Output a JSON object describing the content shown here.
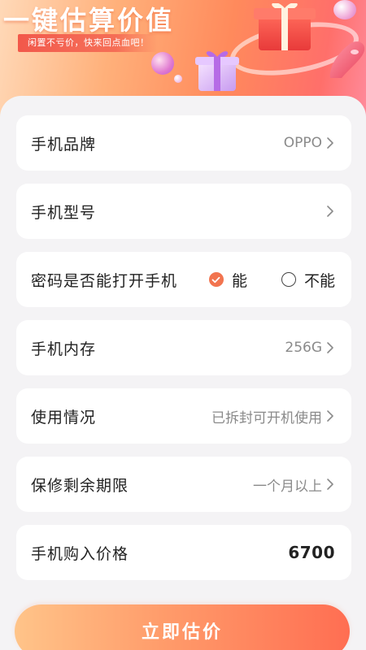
{
  "hero": {
    "title": "一键估算价值",
    "subtitle": "闲置不亏价，快来回点血吧！"
  },
  "form": {
    "rows": [
      {
        "label": "手机品牌",
        "value": "OPPO"
      },
      {
        "label": "手机型号",
        "value": ""
      },
      {
        "label": "密码是否能打开手机",
        "options": [
          "能",
          "不能"
        ],
        "selected": "能"
      },
      {
        "label": "手机内存",
        "value": "256G"
      },
      {
        "label": "使用情况",
        "value": "已拆封可开机使用"
      },
      {
        "label": "保修剩余期限",
        "value": "一个月以上"
      },
      {
        "label": "手机购入价格",
        "value": "6700"
      }
    ]
  },
  "cta": {
    "label": "立即估价"
  },
  "colors": {
    "accent": "#f2744f",
    "background": "#f4f3f5",
    "card": "#ffffff"
  },
  "icons": {
    "chevron": "chevron-right-icon",
    "check": "check-icon"
  }
}
